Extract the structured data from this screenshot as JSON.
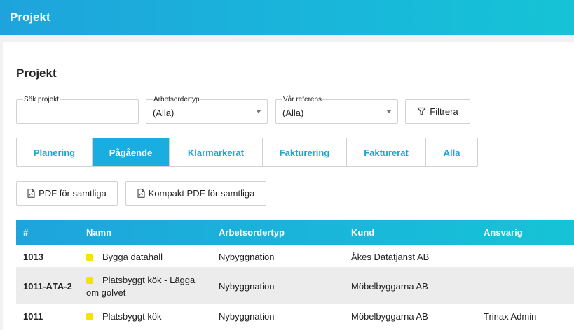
{
  "app": {
    "title": "Projekt"
  },
  "page": {
    "title": "Projekt"
  },
  "filters": {
    "search": {
      "label": "Sök projekt",
      "value": ""
    },
    "order_type": {
      "label": "Arbetsordertyp",
      "value": "(Alla)"
    },
    "reference": {
      "label": "Vår referens",
      "value": "(Alla)"
    },
    "filter_button": "Filtrera"
  },
  "tabs": [
    {
      "label": "Planering",
      "active": false
    },
    {
      "label": "Pågående",
      "active": true
    },
    {
      "label": "Klarmarkerat",
      "active": false
    },
    {
      "label": "Fakturering",
      "active": false
    },
    {
      "label": "Fakturerat",
      "active": false
    },
    {
      "label": "Alla",
      "active": false
    }
  ],
  "actions": {
    "pdf_all": "PDF för samtliga",
    "compact_pdf_all": "Kompakt PDF för samtliga"
  },
  "table": {
    "columns": [
      "#",
      "Namn",
      "Arbetsordertyp",
      "Kund",
      "Ansvarig"
    ],
    "rows": [
      {
        "id": "1013",
        "name": "Bygga datahall",
        "name_line2": "",
        "status_color": "#f5e400",
        "type": "Nybyggnation",
        "customer": "Åkes Datatjänst AB",
        "responsible": ""
      },
      {
        "id": "1011-ÄTA-2",
        "name": "Platsbyggt kök - Lägga",
        "name_line2": "om golvet",
        "status_color": "#f5e400",
        "type": "Nybyggnation",
        "customer": "Möbelbyggarna AB",
        "responsible": ""
      },
      {
        "id": "1011",
        "name": "Platsbyggt kök",
        "name_line2": "",
        "status_color": "#f5e400",
        "type": "Nybyggnation",
        "customer": "Möbelbyggarna AB",
        "responsible": "Trinax Admin"
      }
    ]
  }
}
